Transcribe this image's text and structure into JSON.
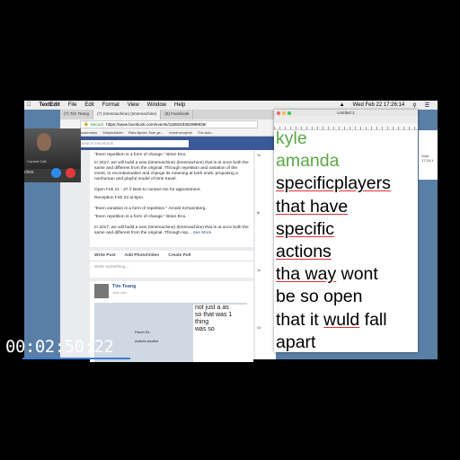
{
  "menubar": {
    "app": "TextEdit",
    "items": [
      "File",
      "Edit",
      "Format",
      "View",
      "Window",
      "Help"
    ],
    "clock": "Wed Feb 22  17:26:14"
  },
  "call": {
    "name": "Current Call",
    "side_text": "ches"
  },
  "browser": {
    "tabs": [
      "(7) Tim Teang",
      "(7) (timemachine) (timemachine)",
      "(8) Facebook"
    ],
    "secure": "Secure",
    "url": "https://www.facebook.com/events/1189153352986936/",
    "bookmarks": [
      "Apps",
      "Bookmarks",
      "SimpleAdder",
      "Rare Aphex Twin ge...",
      "monk+prophet",
      "The Actu"
    ],
    "search_placeholder": "Search Facebook",
    "quote1": "\"Even repetition is a form of change.\" Brian Eno.",
    "para1": "In 2017, we will build a new (timemachine) (timemachine) that is at once both the same and different from the original. Through repetition and variation of the event, to recontextualize and change its meaning at both ends, proposing a nonhuman and playful model of time travel.",
    "open": "Open Feb 21 - 27 // Best to contact me for appointment.",
    "reception": "Reception Feb 23 at 8pm.",
    "quote2": "\"Even variation is a form of repetition.\" Arnold Schoenberg.",
    "quote3": "\"Even repetition is a form of change.\" Brian Eno.",
    "para2": "In 2017, we will build a new (timemachine) (timemachine) that is at once both the same and different from the original. Through rep...",
    "see_more": "See More",
    "write_post": "Write Post",
    "add_photo": "Add Photo/Video",
    "create_poll": "Create Poll",
    "write_something": "Write something...",
    "author": "Tim Teang",
    "post_meta": "Just now",
    "embedded_note": [
      "not just a as",
      "so that was 1",
      "thing",
      "was so"
    ],
    "embedded_name": "Paroh Ss",
    "embedded_name2": "Andrés Azollini",
    "right_col": [
      "Yo",
      "Bi",
      "Jo",
      "Ch"
    ]
  },
  "textedit": {
    "title": "Untitled 2",
    "lines": [
      {
        "text": "kyle",
        "style": "green"
      },
      {
        "text": "amanda",
        "style": "green"
      },
      {
        "text": "specificplayers",
        "style": "spell"
      },
      {
        "text": "that have",
        "style": "spell"
      },
      {
        "text": "specific",
        "style": "spell"
      },
      {
        "text": "actions",
        "style": "spell"
      },
      {
        "text": "tha way wont",
        "style": "mixed",
        "spell_part": "tha way",
        "rest": " wont"
      },
      {
        "text": "be so open",
        "style": "plain"
      },
      {
        "text": "that it wuld fall",
        "style": "mixed2",
        "pre": "that it ",
        "spell_part": "wuld",
        "rest": " fall"
      },
      {
        "text": "apart",
        "style": "plain"
      }
    ]
  },
  "sliver": [
    "Shot",
    "17.24.1"
  ],
  "timecode": "00:02:50;22",
  "colors": {
    "facebook": "#3b5998",
    "green_text": "#5aa845",
    "spell_underline": "#e03030",
    "desktop": "#5a7fa6"
  }
}
